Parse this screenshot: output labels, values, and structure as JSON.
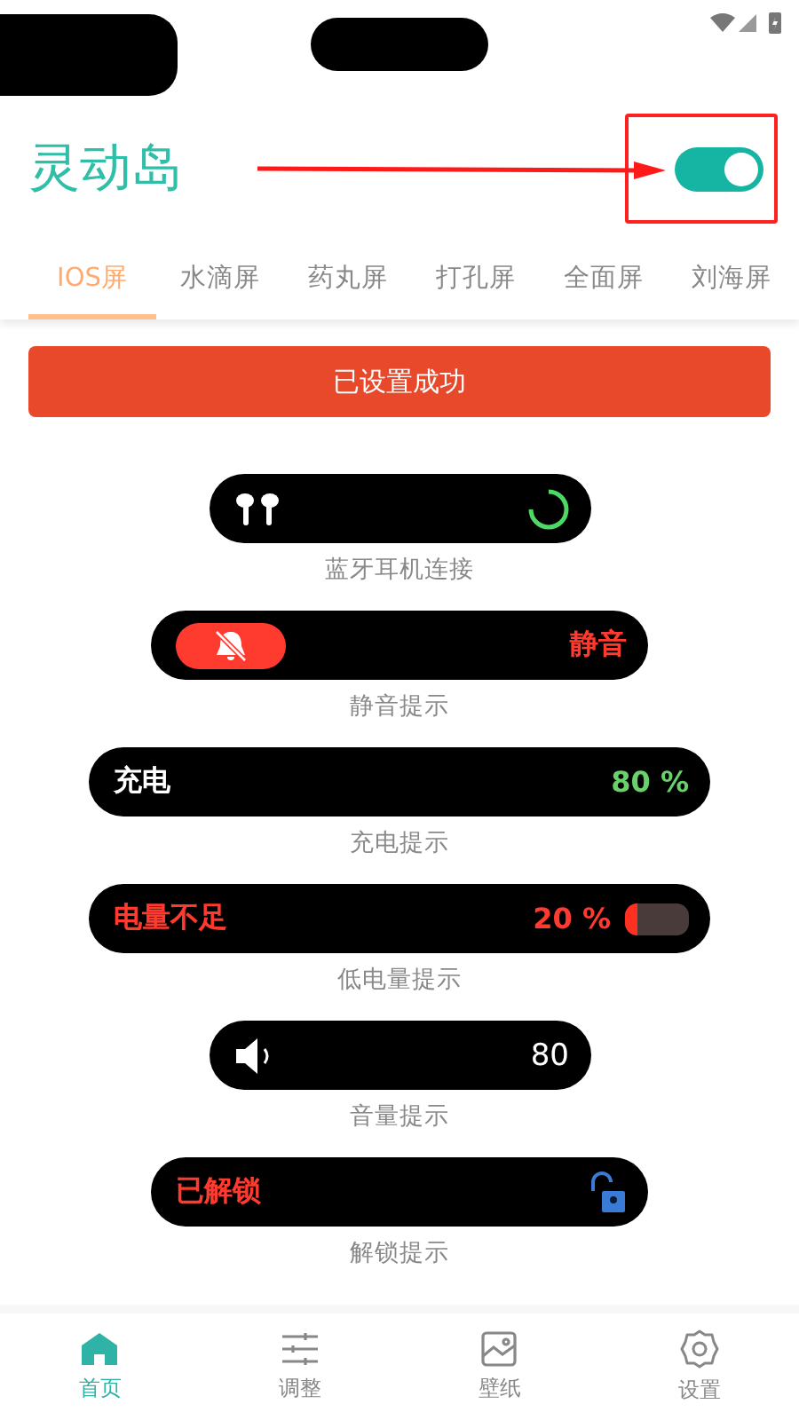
{
  "header": {
    "title": "灵动岛",
    "toggle_on": true
  },
  "tabs": [
    {
      "label": "IOS屏",
      "selected": true
    },
    {
      "label": "水滴屏",
      "selected": false
    },
    {
      "label": "药丸屏",
      "selected": false
    },
    {
      "label": "打孔屏",
      "selected": false
    },
    {
      "label": "全面屏",
      "selected": false
    },
    {
      "label": "刘海屏",
      "selected": false
    }
  ],
  "status_button": "已设置成功",
  "islands": [
    {
      "kind": "earbuds",
      "caption": "蓝牙耳机连接"
    },
    {
      "kind": "mute",
      "text": "静音",
      "caption": "静音提示"
    },
    {
      "kind": "charging",
      "text": "充电",
      "value": "80 %",
      "caption": "充电提示"
    },
    {
      "kind": "low-battery",
      "text": "电量不足",
      "value": "20 %",
      "level": 0.2,
      "caption": "低电量提示"
    },
    {
      "kind": "volume",
      "value": "80",
      "caption": "音量提示"
    },
    {
      "kind": "unlock",
      "text": "已解锁",
      "caption": "解锁提示"
    }
  ],
  "nav": [
    {
      "label": "首页",
      "kind": "home",
      "selected": true
    },
    {
      "label": "调整",
      "kind": "adjust",
      "selected": false
    },
    {
      "label": "壁纸",
      "kind": "wallpaper",
      "selected": false
    },
    {
      "label": "设置",
      "kind": "settings",
      "selected": false
    }
  ]
}
